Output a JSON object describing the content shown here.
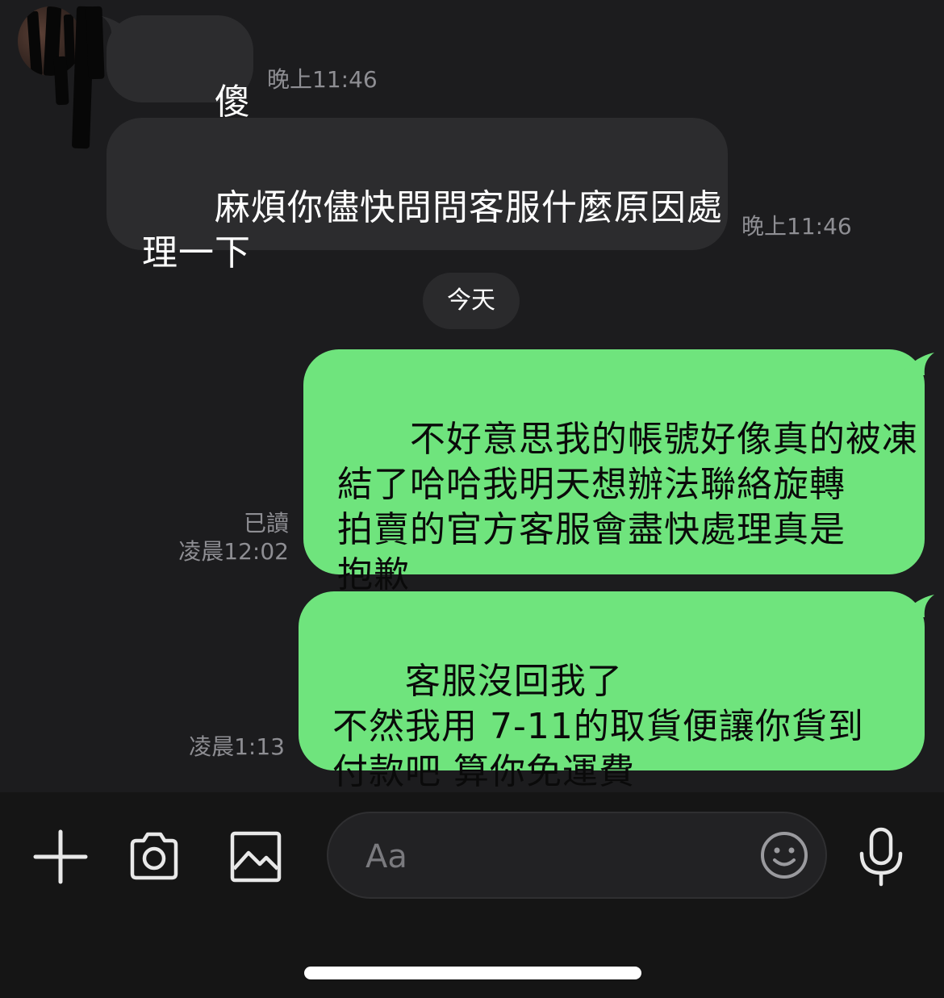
{
  "messages": [
    {
      "direction": "incoming",
      "text": "傻眼",
      "time": "晚上11:46"
    },
    {
      "direction": "incoming",
      "text": "麻煩你儘快問問客服什麼原因處\n理一下",
      "time": "晚上11:46"
    },
    {
      "direction": "outgoing",
      "text": "不好意思我的帳號好像真的被凍\n結了哈哈我明天想辦法聯絡旋轉\n拍賣的官方客服會盡快處理真是\n抱歉",
      "read": "已讀",
      "time": "凌晨12:02"
    },
    {
      "direction": "outgoing",
      "text": "客服沒回我了\n不然我用 7-11的取貨便讓你貨到\n付款吧 算你免運費",
      "time": "凌晨1:13"
    }
  ],
  "date_divider": "今天",
  "composer": {
    "placeholder": "Aa",
    "icons": {
      "add": "plus-icon",
      "camera": "camera-icon",
      "gallery": "image-icon",
      "emoji": "emoji-icon",
      "voice": "microphone-icon"
    }
  },
  "colors": {
    "background": "#1c1c1e",
    "incoming_bubble": "#2c2c2e",
    "outgoing_bubble": "#6fe47d",
    "timestamp": "#8e8e93"
  }
}
